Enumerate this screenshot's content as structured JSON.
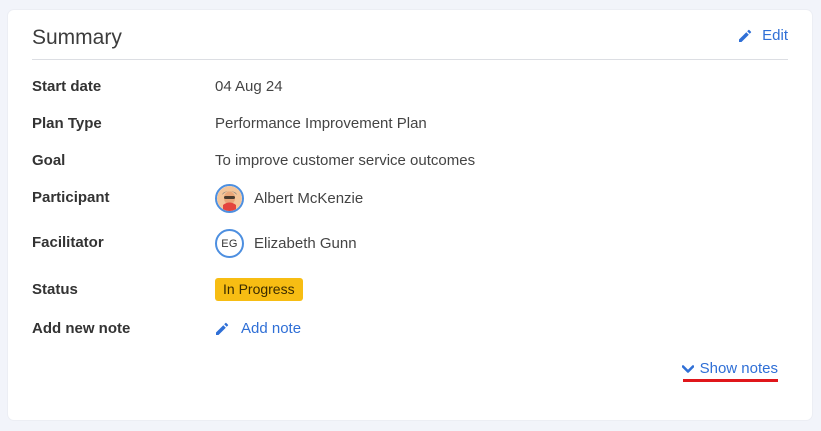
{
  "header": {
    "title": "Summary",
    "edit_label": "Edit"
  },
  "fields": {
    "start_date": {
      "label": "Start date",
      "value": "04 Aug 24"
    },
    "plan_type": {
      "label": "Plan Type",
      "value": "Performance Improvement Plan"
    },
    "goal": {
      "label": "Goal",
      "value": "To improve customer service outcomes"
    },
    "participant": {
      "label": "Participant",
      "name": "Albert McKenzie"
    },
    "facilitator": {
      "label": "Facilitator",
      "name": "Elizabeth Gunn",
      "initials": "EG"
    },
    "status": {
      "label": "Status",
      "value": "In Progress",
      "color": "#f7bd13"
    },
    "add_note": {
      "label": "Add new note",
      "link": "Add note"
    }
  },
  "footer": {
    "show_notes_label": "Show notes"
  },
  "colors": {
    "accent": "#2f6fd6",
    "status_badge": "#f7bd13",
    "highlight_underline": "#e0161b"
  },
  "icons": {
    "edit": "pencil-icon",
    "add_note": "pencil-icon",
    "show_notes": "chevron-down-icon",
    "participant_avatar": "avatar-photo"
  }
}
